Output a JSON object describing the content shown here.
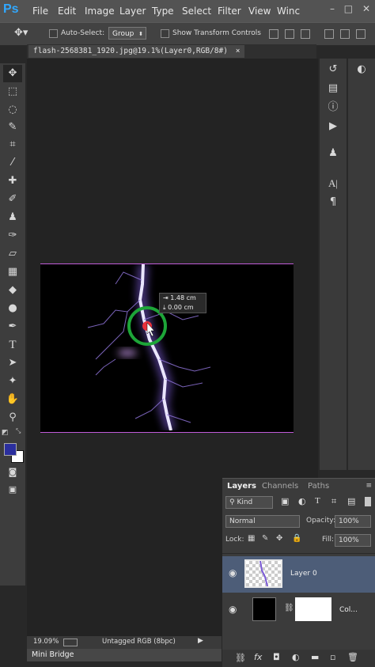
{
  "app": {
    "logo": "Ps"
  },
  "menu": [
    "File",
    "Edit",
    "Image",
    "Layer",
    "Type",
    "Select",
    "Filter",
    "View",
    "Winc"
  ],
  "window_buttons": {
    "minimize": "–",
    "maximize": "□",
    "close": "✕"
  },
  "options_bar": {
    "auto_select_label": "Auto-Select:",
    "auto_select_value": "Group",
    "transform_controls_label": "Show Transform Controls"
  },
  "document": {
    "tab_title": "flash-2568381_1920.jpg@19.1%(Layer0,RGB/8#)",
    "tab_close": "×"
  },
  "measure": {
    "dx": "1.48 cm",
    "dy": "0.00 cm"
  },
  "status": {
    "zoom": "19.09%",
    "profile": "Untagged RGB (8bpc)"
  },
  "mini_bridge": {
    "label": "Mini Bridge"
  },
  "layers_panel": {
    "tabs": [
      "Layers",
      "Channels",
      "Paths"
    ],
    "filter_kind": "Kind",
    "blend_mode": "Normal",
    "opacity_label": "Opacity:",
    "opacity_value": "100%",
    "lock_label": "Lock:",
    "fill_label": "Fill:",
    "fill_value": "100%",
    "layers": [
      {
        "name": "Layer 0",
        "selected": true
      },
      {
        "name": "Col...",
        "selected": false
      }
    ]
  },
  "colors": {
    "foreground": "#2b2f9e",
    "background": "#ffffff",
    "accent": "#31a8ff",
    "selection_border": "#c05bd8"
  }
}
